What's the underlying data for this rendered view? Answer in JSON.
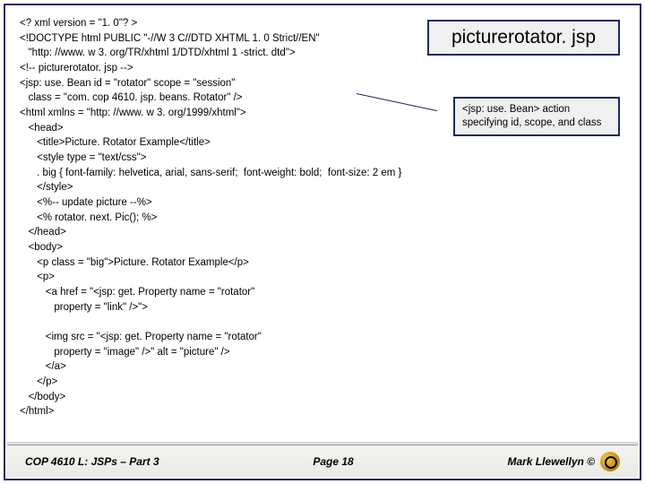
{
  "title_box": "picturerotator. jsp",
  "callout": "<jsp: use. Bean> action specifying id, scope, and class",
  "code": "<? xml version = \"1. 0\"? >\n<!DOCTYPE html PUBLIC \"-//W 3 C//DTD XHTML 1. 0 Strict//EN\"\n   \"http: //www. w 3. org/TR/xhtml 1/DTD/xhtml 1 -strict. dtd\">\n<!-- picturerotator. jsp -->\n<jsp: use. Bean id = \"rotator\" scope = \"session\"\n   class = \"com. cop 4610. jsp. beans. Rotator\" />\n<html xmlns = \"http: //www. w 3. org/1999/xhtml\">\n   <head>\n      <title>Picture. Rotator Example</title>\n      <style type = \"text/css\">\n      . big { font-family: helvetica, arial, sans-serif;  font-weight: bold;  font-size: 2 em }\n      </style>\n      <%-- update picture --%>\n      <% rotator. next. Pic(); %>\n   </head>\n   <body>\n      <p class = \"big\">Picture. Rotator Example</p>\n      <p>\n         <a href = \"<jsp: get. Property name = \"rotator\"\n            property = \"link\" />\">\n\n         <img src = \"<jsp: get. Property name = \"rotator\"\n            property = \"image\" />\" alt = \"picture\" />\n         </a>\n      </p>\n   </body>\n</html>",
  "footer": {
    "left": "COP 4610 L: JSPs – Part 3",
    "center": "Page 18",
    "right": "Mark Llewellyn ©"
  }
}
